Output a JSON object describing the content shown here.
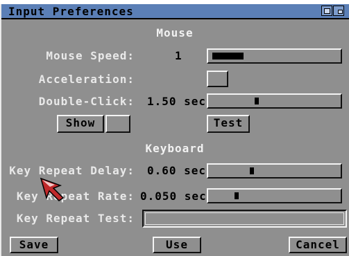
{
  "window": {
    "title": "Input Preferences",
    "gadgets": [
      "depth-icon",
      "zoom-icon"
    ]
  },
  "mouse": {
    "section_title": "Mouse",
    "speed_label": "Mouse Speed:",
    "speed_value": "1",
    "speed_level": 0.25,
    "acceleration_label": "Acceleration:",
    "acceleration_checked": false,
    "double_click_label": "Double-Click:",
    "double_click_value": "1.50 sec",
    "double_click_level": 0.34,
    "show_button": "Show",
    "test_button": "Test"
  },
  "keyboard": {
    "section_title": "Keyboard",
    "repeat_delay_label": "Key Repeat Delay:",
    "repeat_delay_value": "0.60 sec",
    "repeat_delay_level": 0.3,
    "repeat_rate_label": "Key Repeat Rate:",
    "repeat_rate_value": "0.050 sec",
    "repeat_rate_level": 0.18,
    "repeat_test_label": "Key Repeat Test:",
    "repeat_test_value": ""
  },
  "actions": {
    "save": "Save",
    "use": "Use",
    "cancel": "Cancel"
  },
  "colors": {
    "window_bg": "#8f8f8f",
    "titlebar": "#5b7fb6",
    "label_text": "#e9e9e9",
    "value_text": "#000000"
  }
}
